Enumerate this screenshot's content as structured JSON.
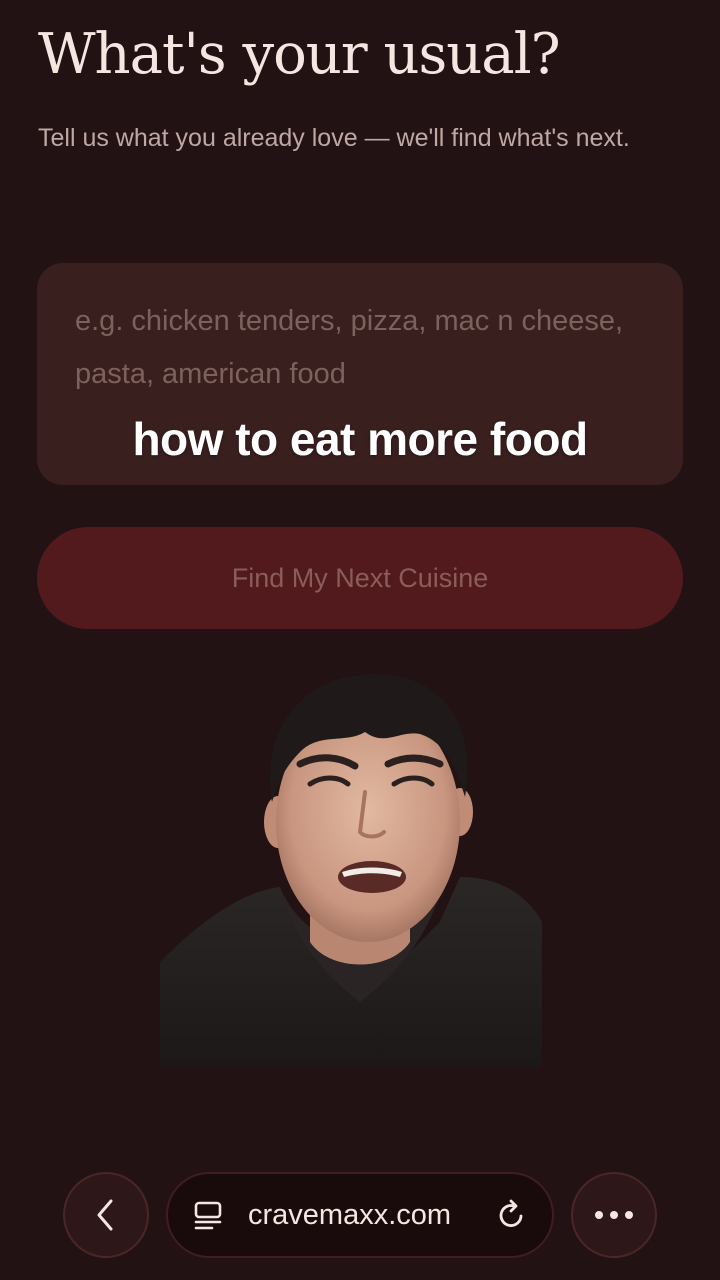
{
  "header": {
    "title": "What's your usual?",
    "subtitle": "Tell us what you already love — we'll find what's next."
  },
  "input": {
    "placeholder": "e.g. chicken tenders, pizza, mac n cheese, pasta, american food",
    "value": ""
  },
  "caption": "how to eat more food",
  "cta": {
    "label": "Find My Next Cuisine"
  },
  "browser_bar": {
    "url": "cravemaxx.com",
    "back_icon": "chevron-left-icon",
    "tabs_icon": "page-menu-icon",
    "reload_icon": "reload-icon",
    "more_icon": "more-dots-icon"
  },
  "colors": {
    "background": "#221214",
    "input_background": "#3a1f1f",
    "button_background": "#521a1c",
    "title_text": "#f4e6e1"
  }
}
